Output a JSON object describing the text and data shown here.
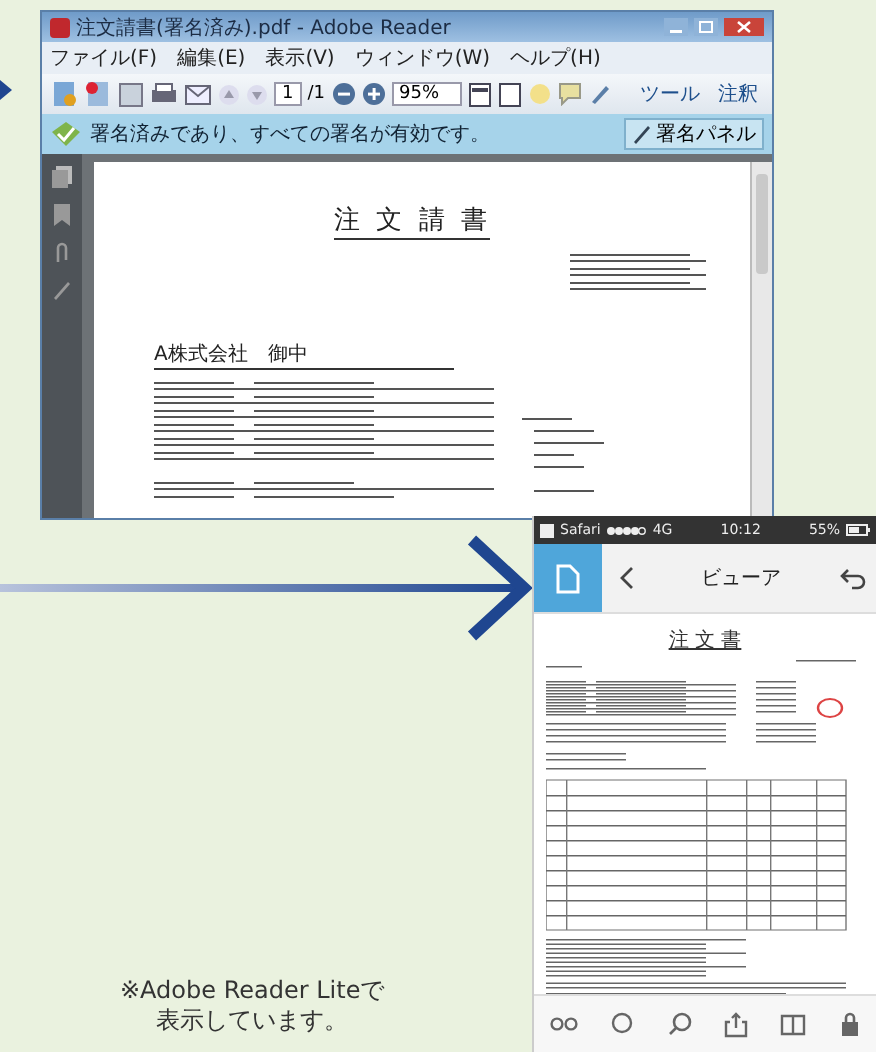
{
  "desktop_window": {
    "title": "注文請書(署名済み).pdf - Adobe Reader",
    "menu": [
      "ファイル(F)",
      "編集(E)",
      "表示(V)",
      "ウィンドウ(W)",
      "ヘルプ(H)"
    ],
    "toolbar": {
      "page": "1",
      "page_total": "/1",
      "zoom": "95%",
      "buttons": [
        "ツール",
        "注釈"
      ]
    },
    "signature_bar": {
      "message": "署名済みであり、すべての署名が有効です。",
      "button": "署名パネル"
    },
    "document": {
      "heading": "注 文 請 書",
      "addressee": "A株式会社　御中"
    }
  },
  "phone": {
    "status_bar": {
      "carrier": "Safari",
      "network": "4G",
      "time": "10:12",
      "battery": "55%"
    },
    "nav_title": "ビューア",
    "document": {
      "heading": "注 文 書"
    }
  },
  "caption": [
    "※Adobe Reader Liteで",
    "表示しています。"
  ]
}
